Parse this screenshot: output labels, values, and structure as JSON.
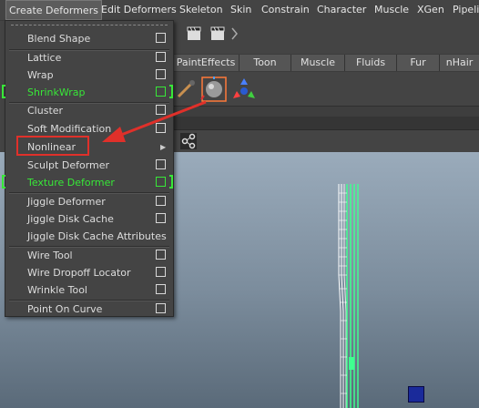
{
  "menubar": {
    "items": [
      "Create Deformers",
      "Edit Deformers",
      "Skeleton",
      "Skin",
      "Constrain",
      "Character",
      "Muscle",
      "XGen",
      "Pipelin"
    ]
  },
  "shelf": {
    "tabs": [
      "PaintEffects",
      "Toon",
      "Muscle",
      "Fluids",
      "Fur",
      "nHair"
    ]
  },
  "menu": {
    "items": [
      {
        "label": "Blend Shape",
        "option_box": true
      },
      {
        "label": "Lattice",
        "option_box": true
      },
      {
        "label": "Wrap",
        "option_box": true
      },
      {
        "label": "ShrinkWrap",
        "option_box": true,
        "highlighted": true
      },
      {
        "label": "Cluster",
        "option_box": true
      },
      {
        "label": "Soft Modification",
        "option_box": true
      },
      {
        "label": "Nonlinear",
        "submenu": true,
        "annotated": true
      },
      {
        "label": "Sculpt Deformer",
        "option_box": true
      },
      {
        "label": "Texture Deformer",
        "option_box": true,
        "highlighted": true
      },
      {
        "label": "Jiggle Deformer",
        "option_box": true
      },
      {
        "label": "Jiggle Disk Cache",
        "option_box": true
      },
      {
        "label": "Jiggle Disk Cache Attributes",
        "option_box": false
      },
      {
        "label": "Wire Tool",
        "option_box": true
      },
      {
        "label": "Wire Dropoff Locator",
        "option_box": true
      },
      {
        "label": "Wrinkle Tool",
        "option_box": true
      },
      {
        "label": "Point On Curve",
        "option_box": true
      }
    ]
  },
  "colors": {
    "highlight": "#38e838",
    "annotation": "#e0302a",
    "viewport_top": "#9aabbb",
    "viewport_bottom": "#5a6a79"
  },
  "icons": [
    "clapboard-icon",
    "clapboard-icon",
    "chevron-right-icon",
    "paint-brush-icon",
    "sphere-select-icon",
    "move-tool-icon",
    "snap-icon"
  ]
}
